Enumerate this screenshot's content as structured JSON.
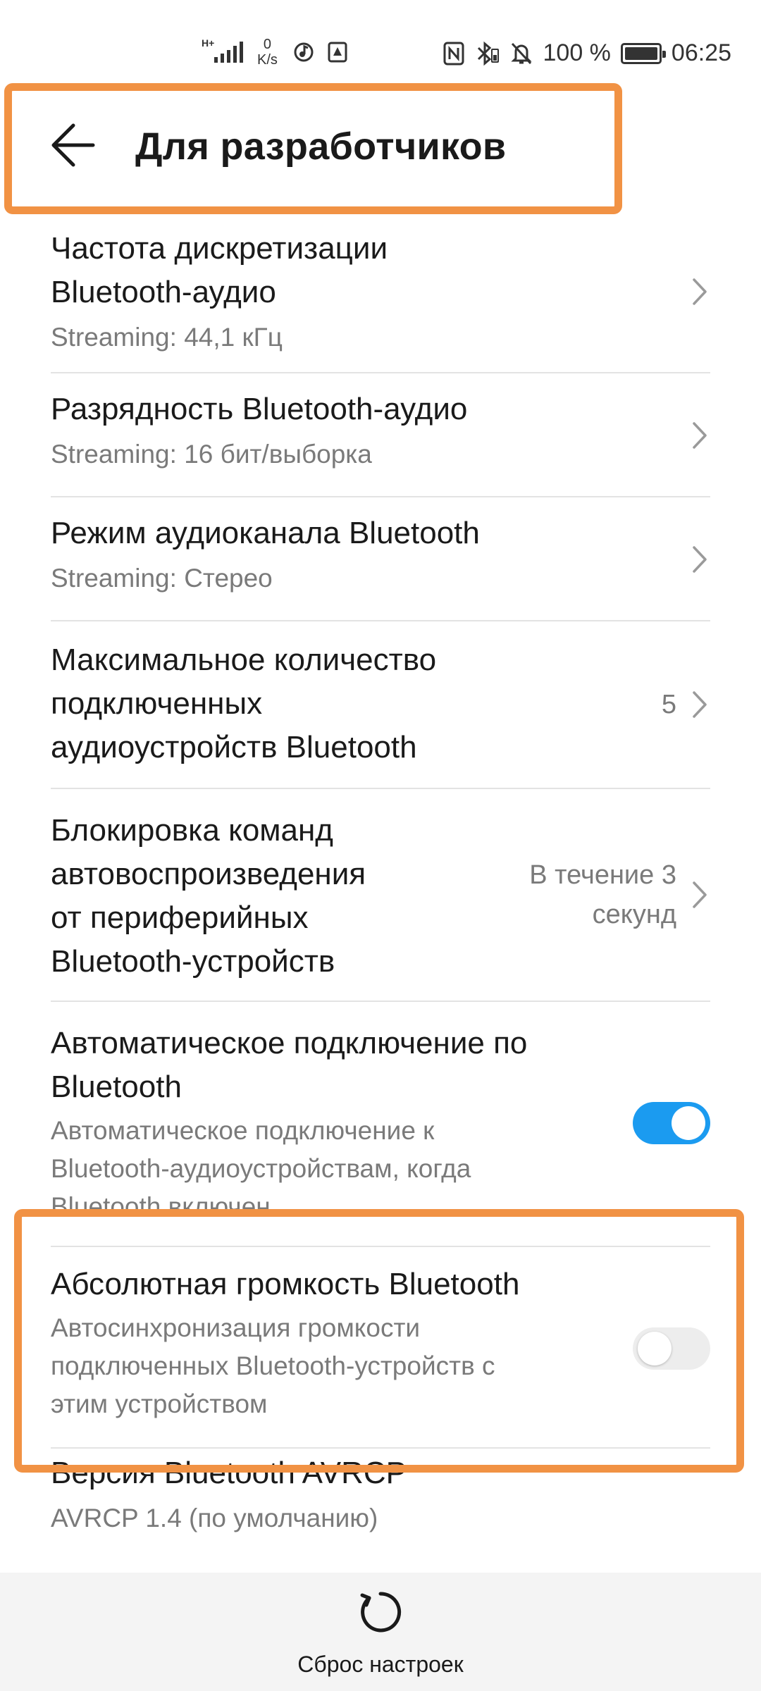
{
  "status_bar": {
    "network_type": "H+",
    "net_speed_value": "0",
    "net_speed_unit": "K/s",
    "battery_percent": "100 %",
    "time": "06:25",
    "icons": [
      "signal-icon",
      "music-icon",
      "screenshot-icon",
      "nfc-icon",
      "bluetooth-icon",
      "mute-icon",
      "battery-icon"
    ]
  },
  "header": {
    "title": "Для разработчиков"
  },
  "items": [
    {
      "main_line1": "Частота дискретизации",
      "main_line2": "Bluetooth-аудио",
      "sub": "Streaming: 44,1 кГц"
    },
    {
      "main": "Разрядность Bluetooth-аудио",
      "sub": "Streaming: 16 бит/выборка"
    },
    {
      "main": "Режим аудиоканала Bluetooth",
      "sub": "Streaming: Стерео"
    },
    {
      "main_line1": "Максимальное количество",
      "main_line2": "подключенных",
      "main_line3": "аудиоустройств Bluetooth",
      "value": "5"
    },
    {
      "main_line1": "Блокировка команд",
      "main_line2": "автовоспроизведения",
      "main_line3": "от периферийных",
      "main_line4": "Bluetooth-устройств",
      "value_line1": "В течение 3",
      "value_line2": "секунд"
    },
    {
      "main_line1": "Автоматическое подключение по",
      "main_line2": "Bluetooth",
      "sub_line1": "Автоматическое подключение к",
      "sub_line2": "Bluetooth-аудиоустройствам, когда",
      "sub_line3": "Bluetooth включен",
      "toggle_state": "on"
    },
    {
      "main": "Абсолютная громкость Bluetooth",
      "sub_line1": "Автосинхронизация громкости",
      "sub_line2": "подключенных Bluetooth-устройств с",
      "sub_line3": "этим устройством",
      "toggle_state": "off"
    },
    {
      "main": "Версия Bluetooth AVRCP",
      "sub": "AVRCP 1.4 (по умолчанию)"
    }
  ],
  "bottom_bar": {
    "reset_label": "Сброс настроек"
  },
  "colors": {
    "accent": "#1b9bf0",
    "highlight": "#f19244",
    "secondary_text": "#7a7a7a"
  }
}
